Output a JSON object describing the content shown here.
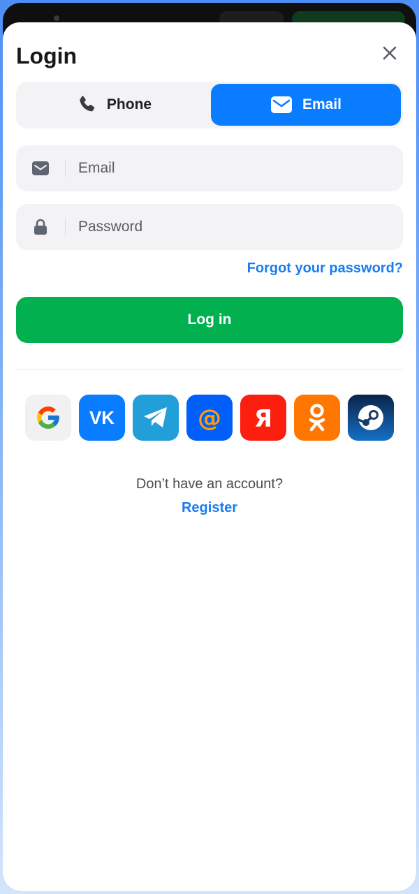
{
  "colors": {
    "primary": "#0a7cff",
    "success": "#03b050",
    "link": "#1a7cf0",
    "field_bg": "#f3f3f5"
  },
  "header": {
    "title": "Login",
    "close_icon": "close-icon"
  },
  "tabs": [
    {
      "label": "Phone",
      "icon": "phone-icon",
      "active": false
    },
    {
      "label": "Email",
      "icon": "envelope-icon",
      "active": true
    }
  ],
  "form": {
    "email": {
      "placeholder": "Email",
      "value": "",
      "icon": "envelope-icon"
    },
    "password": {
      "placeholder": "Password",
      "value": "",
      "icon": "lock-icon"
    },
    "forgot_label": "Forgot your password?",
    "login_label": "Log in"
  },
  "socials": [
    {
      "name": "Google",
      "icon": "google-icon"
    },
    {
      "name": "VK",
      "icon": "vk-icon",
      "glyph": "VK"
    },
    {
      "name": "Telegram",
      "icon": "telegram-icon"
    },
    {
      "name": "Mail.ru",
      "icon": "mail-ru-icon",
      "glyph": "@"
    },
    {
      "name": "Yandex",
      "icon": "yandex-icon",
      "glyph": "Я"
    },
    {
      "name": "Odnoklassniki",
      "icon": "ok-icon"
    },
    {
      "name": "Steam",
      "icon": "steam-icon"
    }
  ],
  "footer": {
    "prompt": "Don’t have an account?",
    "register_label": "Register"
  }
}
